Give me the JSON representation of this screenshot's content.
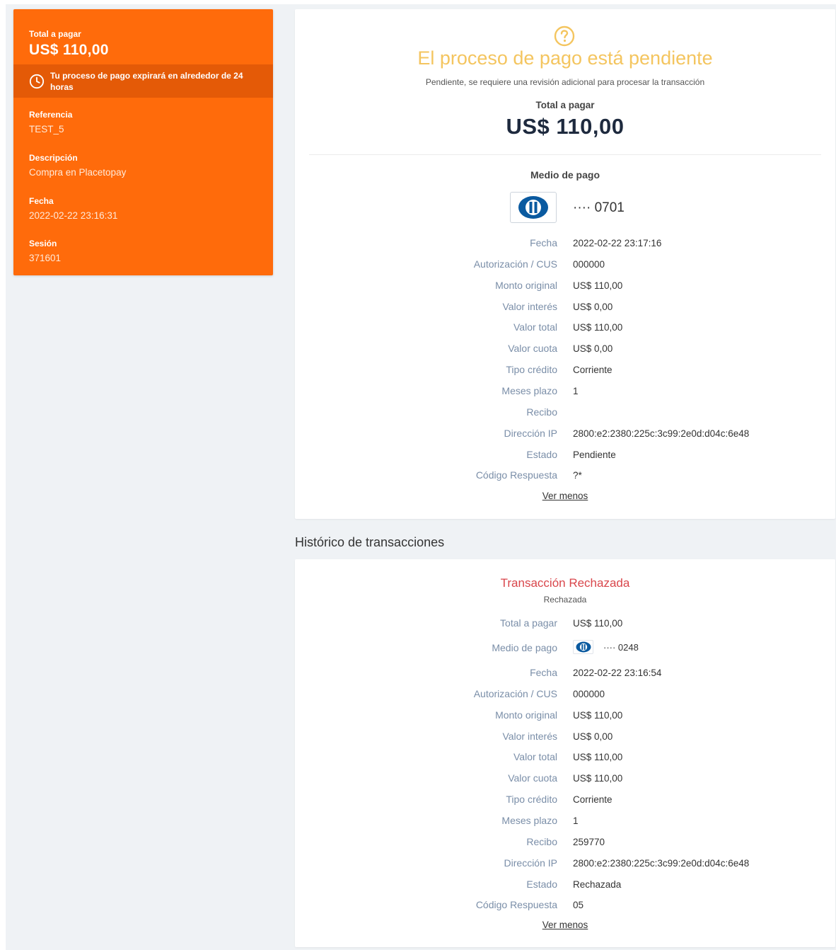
{
  "sidebar": {
    "total_label": "Total a pagar",
    "total_value": "US$ 110,00",
    "expire_text": "Tu proceso de pago expirará en alrededor de 24 horas",
    "fields": [
      {
        "label": "Referencia",
        "value": "TEST_5"
      },
      {
        "label": "Descripción",
        "value": "Compra en Placetopay"
      },
      {
        "label": "Fecha",
        "value": "2022-02-22 23:16:31"
      },
      {
        "label": "Sesión",
        "value": "371601"
      }
    ]
  },
  "main": {
    "icon": "question-circle-icon",
    "title": "El proceso de pago está pendiente",
    "subtitle": "Pendiente, se requiere una revisión adicional para procesar la transacción",
    "total_label": "Total a pagar",
    "total_value": "US$ 110,00",
    "medio_label": "Medio de pago",
    "card_icon": "diners-club-icon",
    "card_digits": "···· 0701",
    "details": [
      {
        "label": "Fecha",
        "value": "2022-02-22 23:17:16"
      },
      {
        "label": "Autorización / CUS",
        "value": "000000"
      },
      {
        "label": "Monto original",
        "value": "US$ 110,00"
      },
      {
        "label": "Valor interés",
        "value": "US$ 0,00"
      },
      {
        "label": "Valor total",
        "value": "US$ 110,00"
      },
      {
        "label": "Valor cuota",
        "value": "US$ 0,00"
      },
      {
        "label": "Tipo crédito",
        "value": "Corriente"
      },
      {
        "label": "Meses plazo",
        "value": "1"
      },
      {
        "label": "Recibo",
        "value": ""
      },
      {
        "label": "Dirección IP",
        "value": "2800:e2:2380:225c:3c99:2e0d:d04c:6e48"
      },
      {
        "label": "Estado",
        "value": "Pendiente"
      },
      {
        "label": "Código Respuesta",
        "value": "?*"
      }
    ],
    "ver_menos": "Ver menos"
  },
  "history": {
    "title": "Histórico de transacciones",
    "transaction": {
      "title": "Transacción Rechazada",
      "subtitle": "Rechazada",
      "total_label": "Total a pagar",
      "total_value": "US$ 110,00",
      "medio_label": "Medio de pago",
      "card_icon": "diners-club-icon",
      "card_digits": "···· 0248",
      "details": [
        {
          "label": "Fecha",
          "value": "2022-02-22 23:16:54"
        },
        {
          "label": "Autorización / CUS",
          "value": "000000"
        },
        {
          "label": "Monto original",
          "value": "US$ 110,00"
        },
        {
          "label": "Valor interés",
          "value": "US$ 0,00"
        },
        {
          "label": "Valor total",
          "value": "US$ 110,00"
        },
        {
          "label": "Valor cuota",
          "value": "US$ 110,00"
        },
        {
          "label": "Tipo crédito",
          "value": "Corriente"
        },
        {
          "label": "Meses plazo",
          "value": "1"
        },
        {
          "label": "Recibo",
          "value": "259770"
        },
        {
          "label": "Dirección IP",
          "value": "2800:e2:2380:225c:3c99:2e0d:d04c:6e48"
        },
        {
          "label": "Estado",
          "value": "Rechazada"
        },
        {
          "label": "Código Respuesta",
          "value": "05"
        }
      ],
      "ver_menos": "Ver menos"
    }
  },
  "colors": {
    "sidebar_bg": "#ff6b0b",
    "sidebar_expire_bg": "#e45a07",
    "pending": "#f4c55f",
    "rejected": "#d9464b",
    "page_bg": "#eff2f5"
  }
}
